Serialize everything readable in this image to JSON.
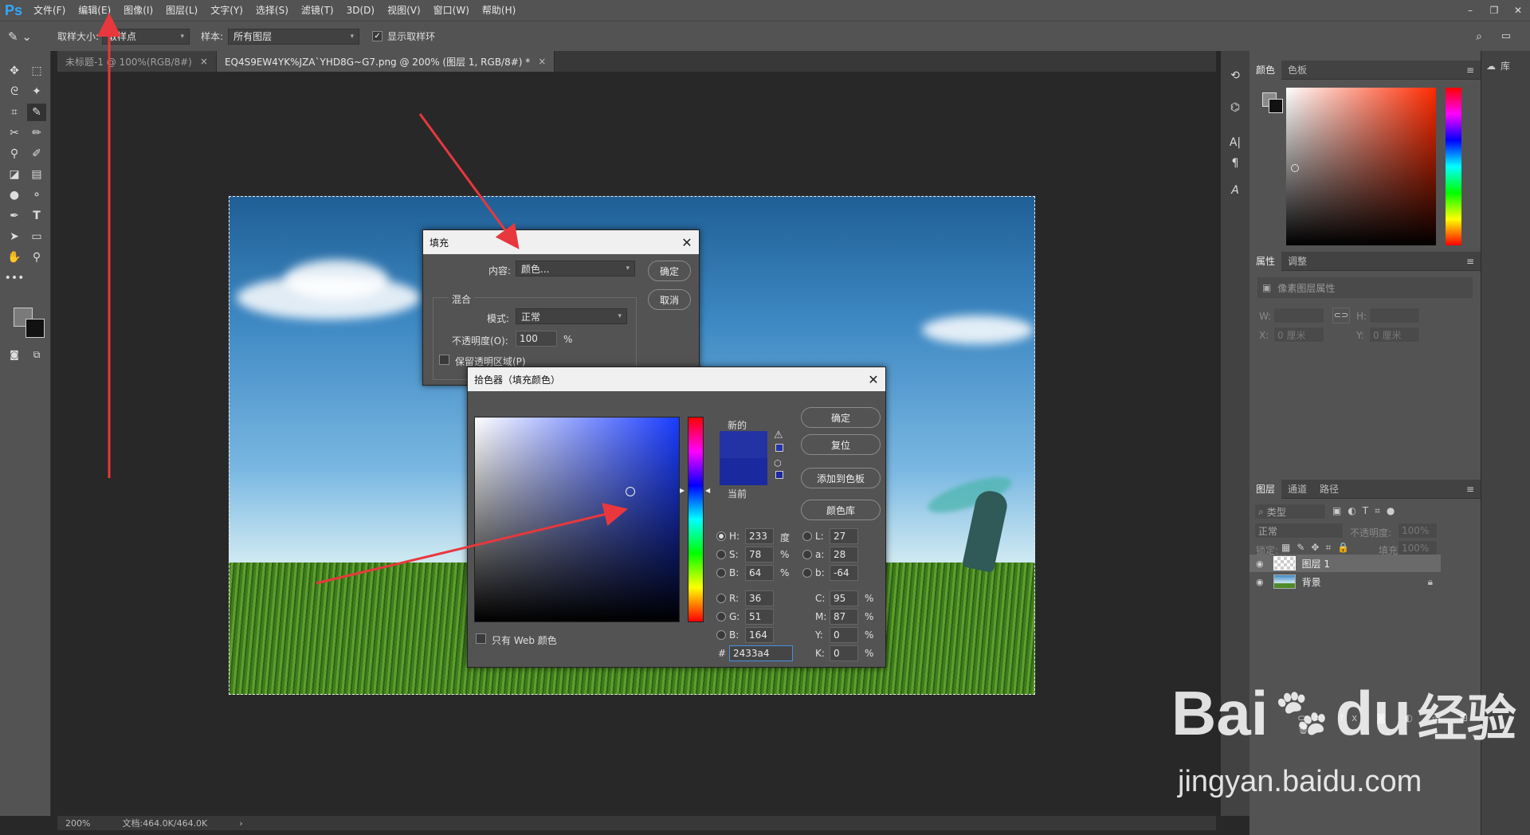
{
  "app": {
    "logo": "Ps"
  },
  "menubar": {
    "items": [
      "文件(F)",
      "编辑(E)",
      "图像(I)",
      "图层(L)",
      "文字(Y)",
      "选择(S)",
      "滤镜(T)",
      "3D(D)",
      "视图(V)",
      "窗口(W)",
      "帮助(H)"
    ]
  },
  "options": {
    "sample_size_label": "取样大小:",
    "sample_size_value": "取样点",
    "sample_label": "样本:",
    "sample_value": "所有图层",
    "show_ring_label": "显示取样环"
  },
  "tabs": [
    {
      "label": "未标题-1 @ 100%(RGB/8#)"
    },
    {
      "label": "EQ4S9EW4YK%JZA`YHD8G~G7.png @ 200% (图层 1, RGB/8#) *"
    }
  ],
  "status": {
    "zoom": "200%",
    "doc": "文档:464.0K/464.0K"
  },
  "fill_dialog": {
    "title": "填充",
    "content_label": "内容:",
    "content_value": "颜色...",
    "ok": "确定",
    "cancel": "取消",
    "blend_group": "混合",
    "mode_label": "模式:",
    "mode_value": "正常",
    "opacity_label": "不透明度(O):",
    "opacity_value": "100",
    "opacity_unit": "%",
    "preserve_label": "保留透明区域(P)"
  },
  "picker": {
    "title": "拾色器（填充颜色）",
    "ok": "确定",
    "reset": "复位",
    "add_swatch": "添加到色板",
    "color_lib": "颜色库",
    "new_label": "新的",
    "current_label": "当前",
    "web_only": "只有 Web 颜色",
    "new_color": "#2433a4",
    "current_color": "#1a2a9e",
    "h_label": "H:",
    "h": "233",
    "h_unit": "度",
    "s_label": "S:",
    "s": "78",
    "s_unit": "%",
    "b_label": "B:",
    "b": "64",
    "b_unit": "%",
    "r_label": "R:",
    "r": "36",
    "g_label": "G:",
    "g": "51",
    "bb_label": "B:",
    "bb": "164",
    "l_label": "L:",
    "l": "27",
    "a_label": "a:",
    "a": "28",
    "lb_label": "b:",
    "lb": "-64",
    "c_label": "C:",
    "c": "95",
    "c_unit": "%",
    "m_label": "M:",
    "m": "87",
    "m_unit": "%",
    "y_label": "Y:",
    "y": "0",
    "y_unit": "%",
    "k_label": "K:",
    "k": "0",
    "k_unit": "%",
    "hex_label": "#",
    "hex": "2433a4"
  },
  "color_panel": {
    "tab1": "颜色",
    "tab2": "色板"
  },
  "props_panel": {
    "tab1": "属性",
    "tab2": "调整",
    "section": "像素图层属性",
    "w_label": "W:",
    "h_label": "H:",
    "x_label": "X:",
    "x_value": "0 厘米",
    "y_label": "Y:",
    "y_value": "0 厘米"
  },
  "layers_panel": {
    "tab1": "图层",
    "tab2": "通道",
    "tab3": "路径",
    "filter_placeholder": "类型",
    "blend": "正常",
    "opacity_label": "不透明度:",
    "opacity_value": "100%",
    "lock_label": "锁定:",
    "fill_label": "填充:",
    "fill_value": "100%",
    "layers": [
      {
        "name": "图层 1"
      },
      {
        "name": "背景"
      }
    ]
  },
  "library": {
    "label": "库"
  },
  "watermark": {
    "brand": "Bai",
    "brand2": "du",
    "cn": "经验",
    "url": "jingyan.baidu.com"
  }
}
